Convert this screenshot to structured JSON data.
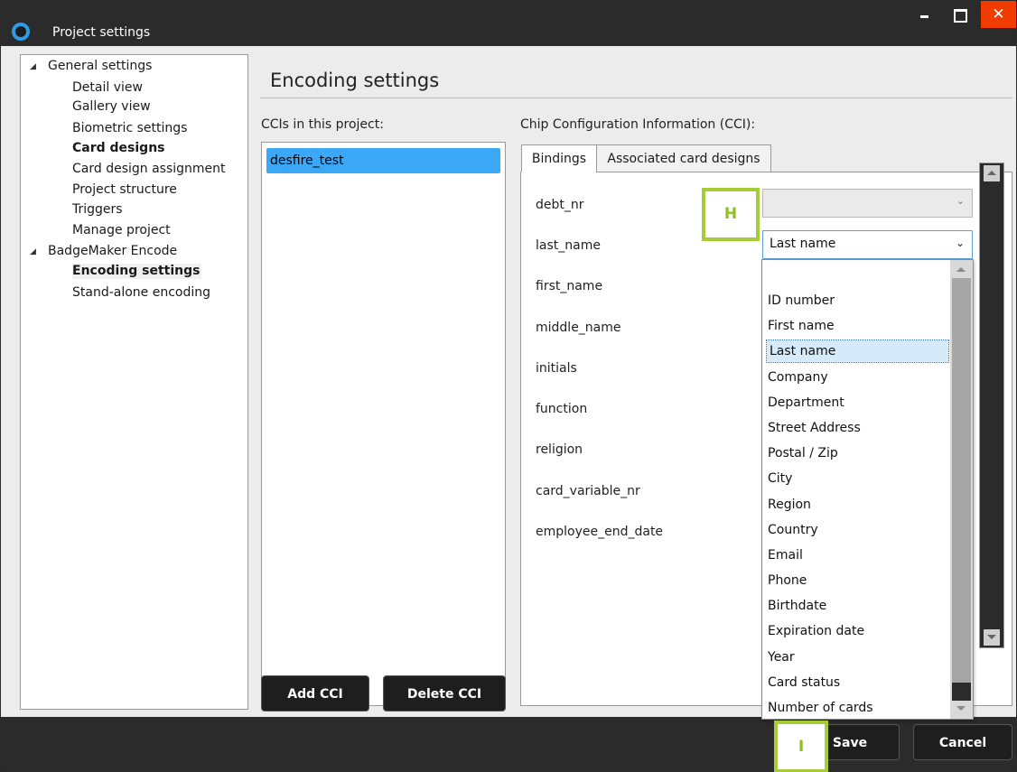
{
  "window": {
    "title": "Project settings"
  },
  "tree": {
    "items": [
      {
        "label": "General settings",
        "level": 0,
        "expanded": true,
        "bold": false
      },
      {
        "label": "Detail view",
        "level": 1,
        "bold": false
      },
      {
        "label": "Gallery view",
        "level": 1,
        "bold": false
      },
      {
        "label": "Biometric settings",
        "level": 1,
        "bold": false
      },
      {
        "label": "Card designs",
        "level": 1,
        "bold": true
      },
      {
        "label": "Card design assignment",
        "level": 1,
        "bold": false
      },
      {
        "label": "Project structure",
        "level": 1,
        "bold": false
      },
      {
        "label": "Triggers",
        "level": 1,
        "bold": false
      },
      {
        "label": "Manage project",
        "level": 1,
        "bold": false
      },
      {
        "label": "BadgeMaker Encode",
        "level": 0,
        "expanded": true,
        "bold": false
      },
      {
        "label": "Encoding settings",
        "level": 1,
        "bold": true,
        "selected": true
      },
      {
        "label": "Stand-alone encoding",
        "level": 1,
        "bold": false
      }
    ]
  },
  "main": {
    "title": "Encoding settings",
    "ccis_label": "CCIs in this project:",
    "cci_items": [
      "desfire_test"
    ],
    "cci_panel_label": "Chip Configuration Information (CCI):",
    "tabs": [
      {
        "label": "Bindings",
        "active": true
      },
      {
        "label": "Associated card designs",
        "active": false
      }
    ],
    "fields": [
      "debt_nr",
      "last_name",
      "first_name",
      "middle_name",
      "initials",
      "function",
      "religion",
      "card_variable_nr",
      "employee_end_date"
    ],
    "debt_nr_value": "",
    "last_name_value": "Last name",
    "dropdown_options": [
      "",
      "ID number",
      "First name",
      "Last name",
      "Company",
      "Department",
      "Street Address",
      "Postal / Zip",
      "City",
      "Region",
      "Country",
      "Email",
      "Phone",
      "Birthdate",
      "Expiration date",
      "Year",
      "Card status",
      "Number of cards"
    ],
    "dropdown_selected": "Last name"
  },
  "buttons": {
    "add_cci": "Add CCI",
    "delete_cci": "Delete CCI",
    "save": "Save",
    "cancel": "Cancel"
  },
  "markers": {
    "h": "H",
    "i": "I"
  },
  "colors": {
    "accent_blue": "#3ba7f7",
    "marker_green": "#a6cc37",
    "close_red": "#f03c00",
    "dark_bar": "#2b2b2b"
  },
  "icons": {
    "app": "app-logo-icon",
    "minimize": "minimize-icon",
    "maximize": "maximize-icon",
    "close": "close-icon",
    "tree_expand": "tree-expanded-icon",
    "combo_arrow": "chevron-down-icon"
  }
}
